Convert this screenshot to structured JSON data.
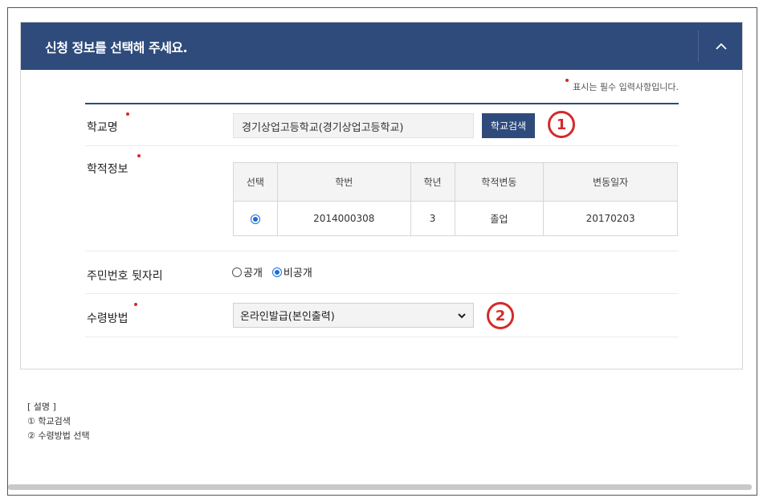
{
  "panel": {
    "title": "신청 정보를 선택해 주세요.",
    "collapse_icon": "chevron-up-icon"
  },
  "required_note": "표시는 필수 입력사항입니다.",
  "form": {
    "school": {
      "label": "학교명",
      "value": "경기상업고등학교(경기상업고등학교)",
      "button": "학교검색",
      "callout": "1"
    },
    "records": {
      "label": "학적정보",
      "headers": [
        "선택",
        "학번",
        "학년",
        "학적변동",
        "변동일자"
      ],
      "rows": [
        {
          "selected": true,
          "student_no": "2014000308",
          "grade": "3",
          "status": "졸업",
          "date": "20170203"
        }
      ]
    },
    "id_suffix": {
      "label": "주민번호 뒷자리",
      "options": [
        {
          "label": "공개",
          "selected": false
        },
        {
          "label": "비공개",
          "selected": true
        }
      ]
    },
    "receive": {
      "label": "수령방법",
      "selected": "온라인발급(본인출력)",
      "callout": "2"
    }
  },
  "description": {
    "heading": "[ 설명 ]",
    "items": [
      "① 학교검색",
      "② 수령방법 선택"
    ]
  },
  "colors": {
    "header_bg": "#2f4b7c",
    "required_dot": "#d42a2a",
    "radio_active": "#1a6fd8"
  }
}
